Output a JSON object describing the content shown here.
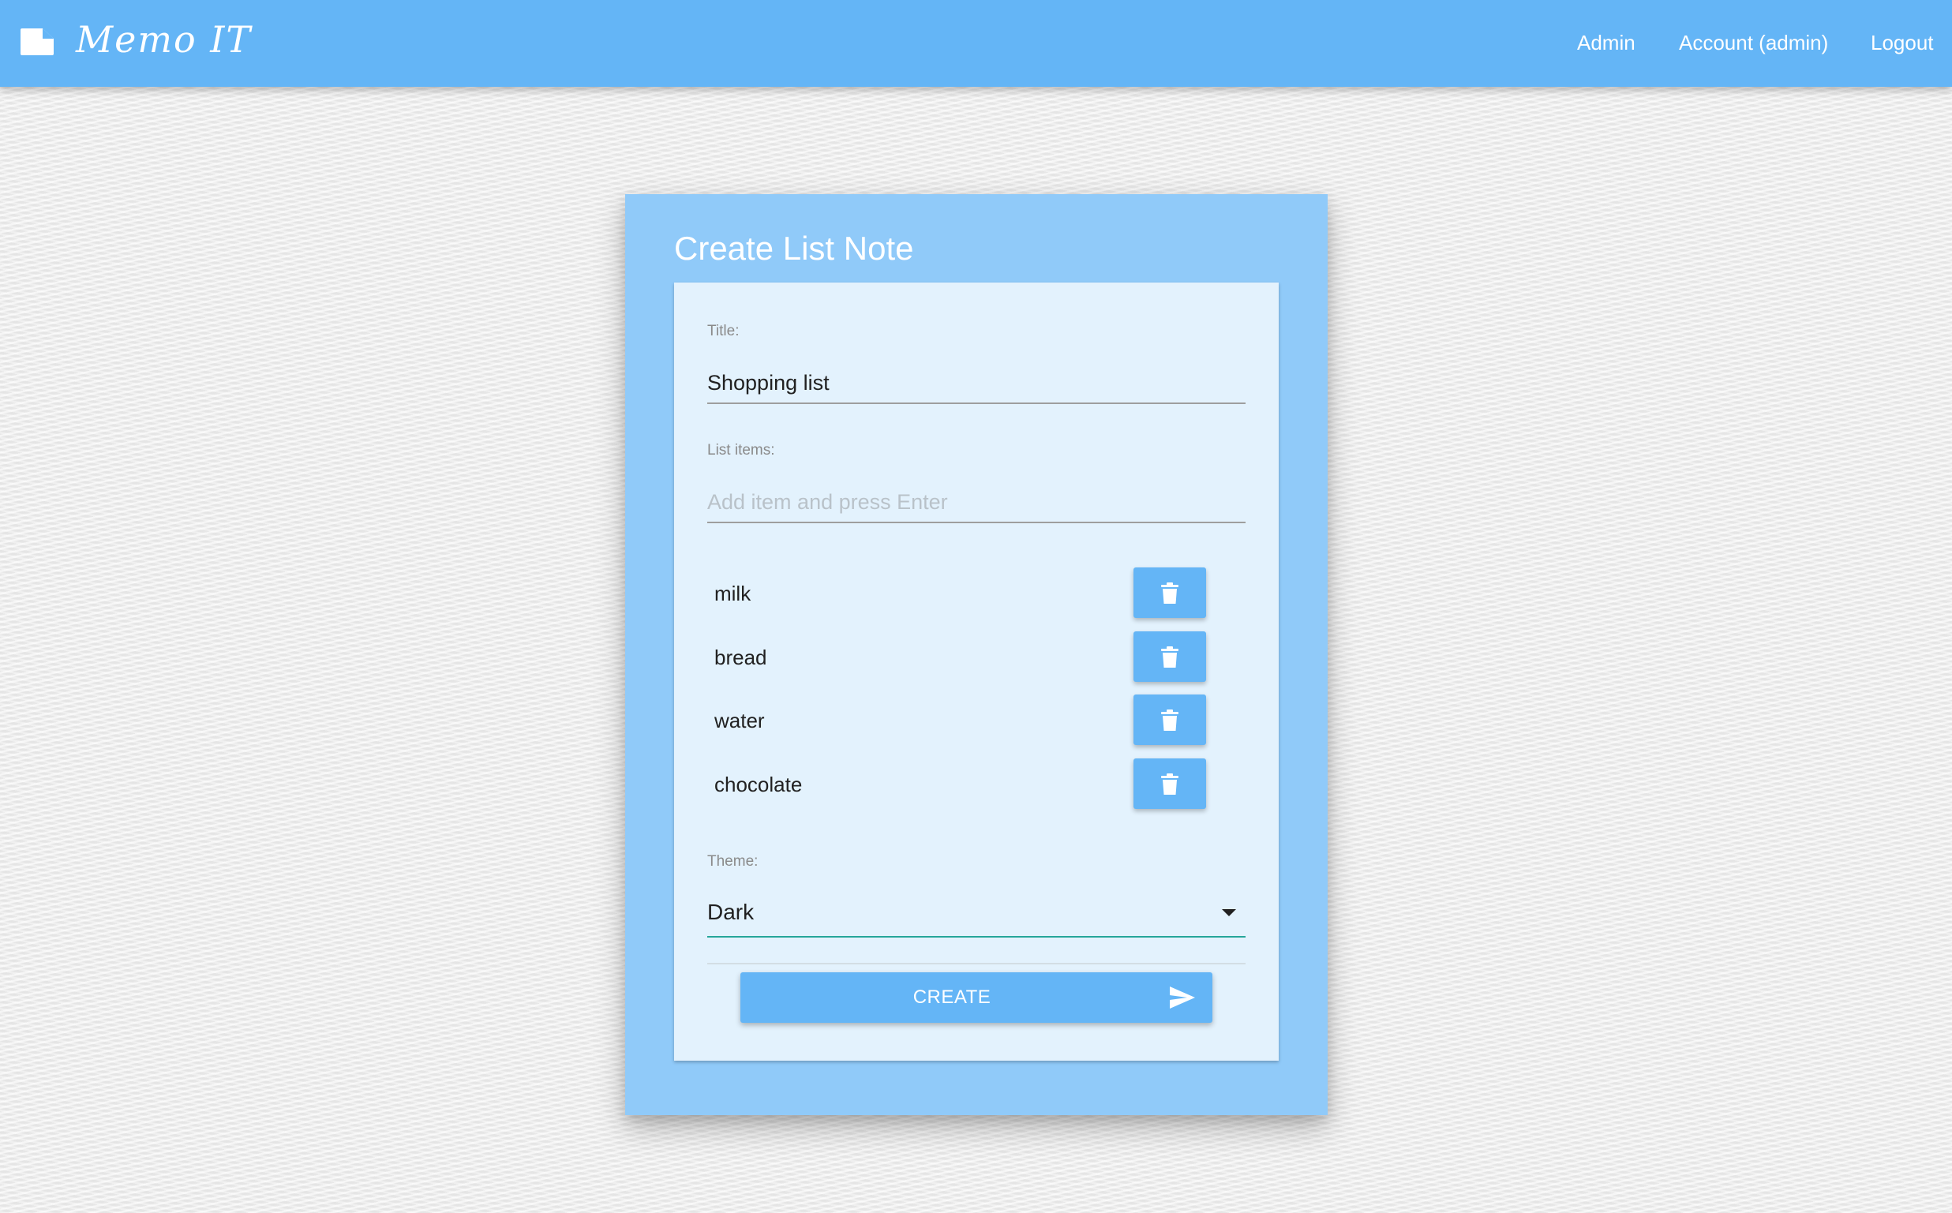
{
  "app": {
    "brand": "Memo IT",
    "brand_icon": "note-icon"
  },
  "nav": {
    "admin": "Admin",
    "account": "Account (admin)",
    "logout": "Logout"
  },
  "form": {
    "heading": "Create List Note",
    "title_label": "Title:",
    "title_value": "Shopping list",
    "items_label": "List items:",
    "items_placeholder": "Add item and press Enter",
    "items": [
      {
        "text": "milk",
        "icon": "trash-icon"
      },
      {
        "text": "bread",
        "icon": "trash-icon"
      },
      {
        "text": "water",
        "icon": "trash-icon"
      },
      {
        "text": "chocolate",
        "icon": "trash-icon"
      }
    ],
    "theme_label": "Theme:",
    "theme_value": "Dark",
    "create_label": "CREATE",
    "create_icon": "send-icon"
  },
  "colors": {
    "primary": "#64b5f6",
    "card": "#90caf9",
    "panel": "#e3f2fd",
    "select_underline": "#26a69a"
  }
}
